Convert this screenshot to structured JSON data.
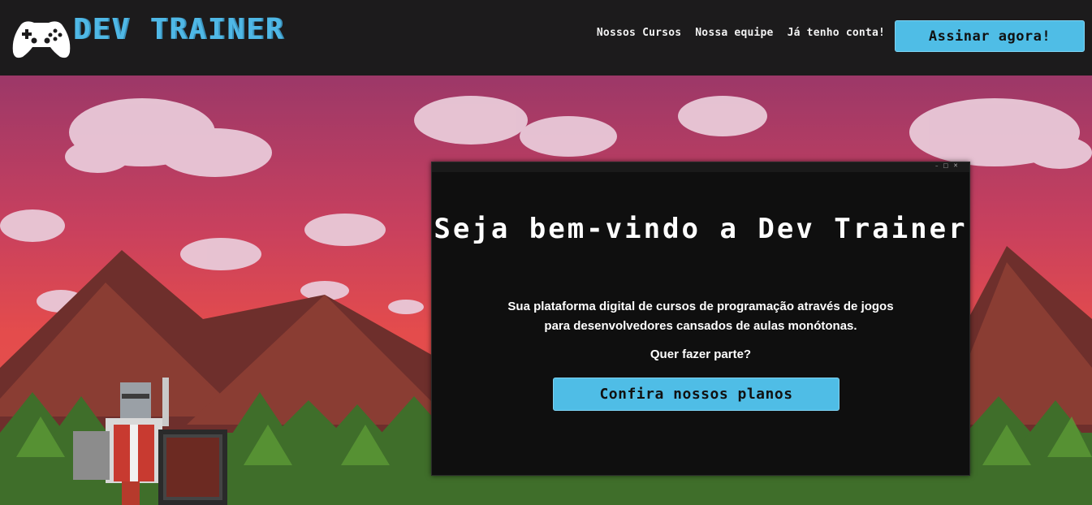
{
  "brand": {
    "name": "DEV TRAINER",
    "logo_icon": "gamepad-icon"
  },
  "nav": {
    "items": [
      {
        "label": "Nossos Cursos"
      },
      {
        "label": "Nossa equipe"
      },
      {
        "label": "Já tenho conta!"
      }
    ],
    "cta_label": "Assinar agora!"
  },
  "hero": {
    "title": "Seja bem-vindo a Dev Trainer",
    "subtitle_line1": "Sua plataforma digital de cursos de programação através de jogos",
    "subtitle_line2": "para desenvolvedores cansados de aulas monótonas.",
    "question": "Quer fazer parte?",
    "cta_label": "Confira nossos planos"
  },
  "colors": {
    "accent": "#4fbde6",
    "header_bg": "#1c1b1c",
    "terminal_bg": "#0f0f0f",
    "sky_top": "#a23a6a",
    "sky_bottom": "#e24b4e"
  }
}
